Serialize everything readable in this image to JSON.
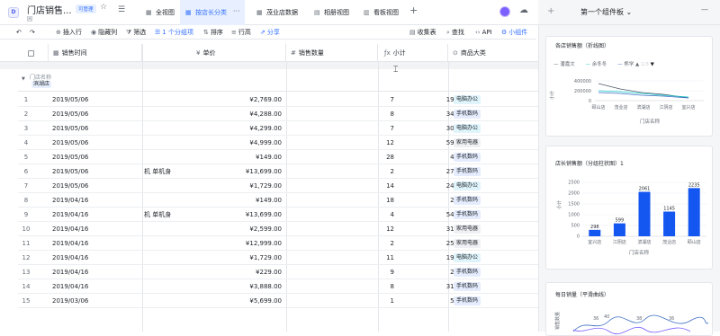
{
  "app": {
    "title": "门店销售...",
    "subtitle": "园",
    "perm_badge": "可管理"
  },
  "tabs": [
    {
      "label": "全视图",
      "icon": "▦"
    },
    {
      "label": "按店长分类",
      "icon": "▦"
    },
    {
      "label": "茂业店数据",
      "icon": "▦"
    },
    {
      "label": "相册视图",
      "icon": "▤"
    },
    {
      "label": "看板视图",
      "icon": "▥"
    }
  ],
  "toolbar": {
    "insert_row": "插入行",
    "hidden_cols": "隐藏列",
    "filter": "筛选",
    "group": "1 个分组项",
    "sort": "排序",
    "row_height": "行高",
    "share": "分享",
    "form": "收集表",
    "find": "查找",
    "api": "API",
    "widget": "小组件"
  },
  "columns": {
    "date": "销售时间",
    "price": "单价",
    "qty": "销售数量",
    "subtotal": "小计",
    "category": "商品大类"
  },
  "group": {
    "field_label": "门店名称",
    "value": "滨湖店"
  },
  "rows": [
    {
      "n": "1",
      "date": "2019/05/06",
      "left": "",
      "price": "¥2,769.00",
      "qty": "7",
      "sub": "19383",
      "cat": "电脑办公",
      "cls": "cat-office"
    },
    {
      "n": "2",
      "date": "2019/05/06",
      "left": "",
      "price": "¥4,288.00",
      "qty": "8",
      "sub": "34304",
      "cat": "手机数码",
      "cls": "cat-phone"
    },
    {
      "n": "3",
      "date": "2019/05/06",
      "left": "",
      "price": "¥4,299.00",
      "qty": "7",
      "sub": "30093",
      "cat": "电脑办公",
      "cls": "cat-office"
    },
    {
      "n": "4",
      "date": "2019/05/06",
      "left": "",
      "price": "¥4,999.00",
      "qty": "12",
      "sub": "59988",
      "cat": "家用电器",
      "cls": "cat-appliance"
    },
    {
      "n": "5",
      "date": "2019/05/06",
      "left": "",
      "price": "¥149.00",
      "qty": "28",
      "sub": "4172",
      "cat": "手机数码",
      "cls": "cat-phone"
    },
    {
      "n": "6",
      "date": "2019/05/06",
      "left": "机 单机身",
      "price": "¥13,699.00",
      "qty": "2",
      "sub": "27398",
      "cat": "手机数码",
      "cls": "cat-phone"
    },
    {
      "n": "7",
      "date": "2019/05/06",
      "left": "",
      "price": "¥1,729.00",
      "qty": "14",
      "sub": "24206",
      "cat": "电脑办公",
      "cls": "cat-office"
    },
    {
      "n": "8",
      "date": "2019/04/16",
      "left": "",
      "price": "¥149.00",
      "qty": "18",
      "sub": "2682",
      "cat": "手机数码",
      "cls": "cat-phone"
    },
    {
      "n": "9",
      "date": "2019/04/16",
      "left": "机 单机身",
      "price": "¥13,699.00",
      "qty": "4",
      "sub": "54796",
      "cat": "手机数码",
      "cls": "cat-phone"
    },
    {
      "n": "10",
      "date": "2019/04/16",
      "left": "",
      "price": "¥2,599.00",
      "qty": "12",
      "sub": "31188",
      "cat": "家用电器",
      "cls": "cat-appliance"
    },
    {
      "n": "11",
      "date": "2019/04/16",
      "left": "",
      "price": "¥12,999.00",
      "qty": "2",
      "sub": "25998",
      "cat": "家用电器",
      "cls": "cat-appliance"
    },
    {
      "n": "12",
      "date": "2019/04/16",
      "left": "",
      "price": "¥1,729.00",
      "qty": "11",
      "sub": "19019",
      "cat": "电脑办公",
      "cls": "cat-office"
    },
    {
      "n": "13",
      "date": "2019/04/16",
      "left": "",
      "price": "¥229.00",
      "qty": "9",
      "sub": "2061",
      "cat": "手机数码",
      "cls": "cat-phone"
    },
    {
      "n": "14",
      "date": "2019/04/16",
      "left": "",
      "price": "¥3,888.00",
      "qty": "8",
      "sub": "31104",
      "cat": "手机数码",
      "cls": "cat-phone"
    },
    {
      "n": "15",
      "date": "2019/03/06",
      "left": "",
      "price": "¥5,699.00",
      "qty": "1",
      "sub": "5699",
      "cat": "手机数码",
      "cls": "cat-phone"
    }
  ],
  "panel": {
    "title": "第一个组件板"
  },
  "colors": {
    "accent": "#3370ff",
    "bar": "#1456f0",
    "line1": "#4e5969",
    "line2": "#14c9c9",
    "line3": "#3b6cc4"
  },
  "chart_data": [
    {
      "type": "line",
      "title": "各店销售额（折线图）",
      "xlabel": "门店名称",
      "ylabel": "小计",
      "categories": [
        "颐山店",
        "茂业店",
        "滨湖店",
        "江阴店",
        "宜兴店"
      ],
      "legend": [
        "潘嘉文",
        "余冬冬",
        "熊学"
      ],
      "legend_page": "1/3",
      "yticks": [
        "0",
        "200000",
        "400000"
      ],
      "ylim": [
        0,
        400000
      ]
    },
    {
      "type": "bar",
      "title": "店长销售额（分组柱状图）1",
      "xlabel": "门店名称",
      "ylabel": "小计",
      "categories": [
        "宜兴店",
        "江阴店",
        "滨湖店",
        "茂业店",
        "颐山店"
      ],
      "values": [
        298,
        599,
        2061,
        1145,
        2235
      ],
      "value_labels": [
        "298",
        "599",
        "2061",
        "1145",
        "2235"
      ],
      "yticks": [
        "0",
        "500",
        "1000",
        "1500",
        "2000",
        "2500"
      ],
      "ylim": [
        0,
        2500
      ]
    },
    {
      "type": "line",
      "title": "每日销量（平滑曲线）",
      "ylabel": "销售数量",
      "visible_labels": [
        "36",
        "40",
        "38",
        "36"
      ]
    }
  ]
}
